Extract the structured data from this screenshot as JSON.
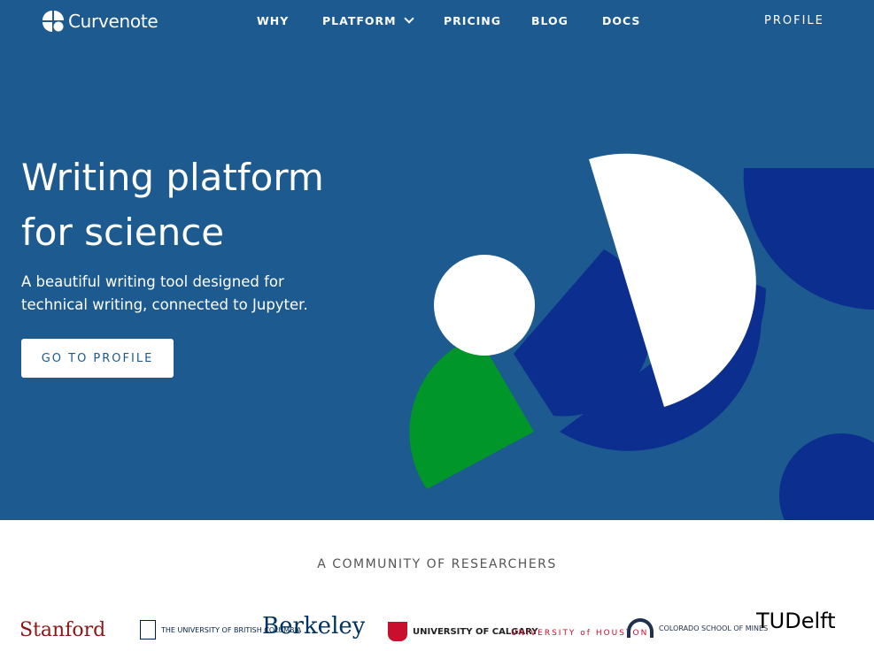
{
  "brand": {
    "name": "Curvenote"
  },
  "nav": {
    "items": [
      {
        "label": "WHY"
      },
      {
        "label": "PLATFORM"
      },
      {
        "label": "PRICING"
      },
      {
        "label": "BLOG"
      },
      {
        "label": "DOCS"
      }
    ],
    "profile_label": "PROFILE"
  },
  "hero": {
    "title_line1": "Writing platform",
    "title_line2": "for science",
    "subtitle": "A beautiful writing tool designed for technical writing, connected to Jupyter.",
    "cta_label": "GO TO PROFILE"
  },
  "community": {
    "heading": "A COMMUNITY OF RESEARCHERS",
    "logos": [
      {
        "text": "Stanford"
      },
      {
        "text": "THE UNIVERSITY OF BRITISH COLUMBIA"
      },
      {
        "text": "Berkeley"
      },
      {
        "text": "UNIVERSITY OF CALGARY"
      },
      {
        "text": "UNIVERSITY of HOUSTON"
      },
      {
        "text": "COLORADO SCHOOL OF MINES"
      },
      {
        "text": "TUDelft"
      }
    ]
  },
  "colors": {
    "hero_bg": "#1c5a8f",
    "shape_navy": "#0b2e8f",
    "shape_green": "#00962a",
    "white": "#ffffff"
  }
}
